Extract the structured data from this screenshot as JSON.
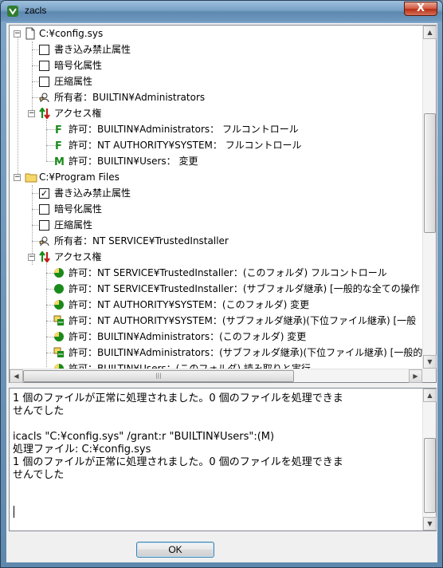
{
  "window": {
    "title": "zacls",
    "close_label": "X"
  },
  "tree": {
    "rows": [
      {
        "label": "C:¥config.sys"
      },
      {
        "label": "書き込み禁止属性",
        "checked": false
      },
      {
        "label": "暗号化属性",
        "checked": false
      },
      {
        "label": "圧縮属性",
        "checked": false
      },
      {
        "label": "所有者：BUILTIN¥Administrators"
      },
      {
        "label": "アクセス権"
      },
      {
        "label": "許可：BUILTIN¥Administrators： フルコントロール",
        "icon_letter": "F"
      },
      {
        "label": "許可：NT AUTHORITY¥SYSTEM： フルコントロール",
        "icon_letter": "F"
      },
      {
        "label": "許可：BUILTIN¥Users： 変更",
        "icon_letter": "M"
      },
      {
        "label": "C:¥Program Files"
      },
      {
        "label": "書き込み禁止属性",
        "checked": true
      },
      {
        "label": "暗号化属性",
        "checked": false
      },
      {
        "label": "圧縮属性",
        "checked": false
      },
      {
        "label": "所有者：NT SERVICE¥TrustedInstaller"
      },
      {
        "label": "アクセス権"
      },
      {
        "label": "許可：NT SERVICE¥TrustedInstaller：(このフォルダ) フルコントロール"
      },
      {
        "label": "許可：NT SERVICE¥TrustedInstaller：(サブフォルダ継承) [一般的な全ての操作"
      },
      {
        "label": "許可：NT AUTHORITY¥SYSTEM：(このフォルダ) 変更"
      },
      {
        "label": "許可：NT AUTHORITY¥SYSTEM：(サブフォルダ継承)(下位ファイル継承) [一般"
      },
      {
        "label": "許可：BUILTIN¥Administrators：(このフォルダ) 変更"
      },
      {
        "label": "許可：BUILTIN¥Administrators：(サブフォルダ継承)(下位ファイル継承) [一般的"
      },
      {
        "label": "許可：BUILTIN¥Users：(このフォルダ) 読み取りと実行"
      }
    ]
  },
  "output": {
    "text": "1 個のファイルが正常に処理されました。0 個のファイルを処理できま\nせんでした\n\nicacls \"C:¥config.sys\" /grant:r \"BUILTIN¥Users\":(M)\n処理ファイル: C:¥config.sys\n1 個のファイルが正常に処理されました。0 個のファイルを処理できま\nせんでした"
  },
  "buttons": {
    "ok_label": "OK"
  },
  "colors": {
    "permission_green": "#1a8a1a",
    "deny_red": "#c0201a",
    "folder_yellow": "#f6d86a"
  }
}
